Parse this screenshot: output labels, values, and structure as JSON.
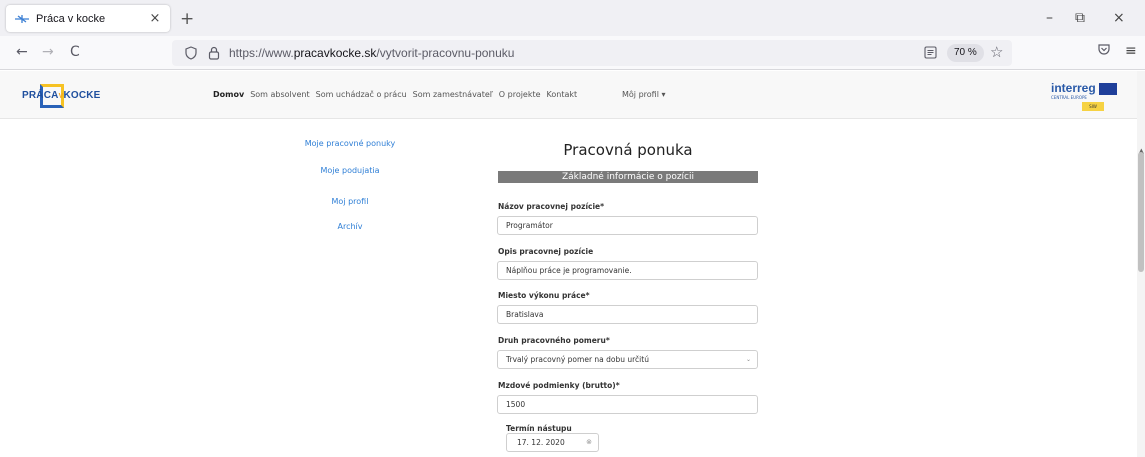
{
  "browser": {
    "tab_title": "Práca v kocke",
    "tab_close": "×",
    "new_tab": "+",
    "url_prefix": "https://www.",
    "url_domain": "pracavkocke.sk",
    "url_path": "/vytvorit-pracovnu-ponuku",
    "zoom": "70 %",
    "window_controls": {
      "minimize": "–",
      "restore": "⧉",
      "close": "×"
    },
    "nav": {
      "back": "←",
      "forward": "→",
      "reload": "C"
    },
    "star": "☆",
    "menu": "≡"
  },
  "site": {
    "logo_left": "PRÁCA",
    "logo_mid": "V",
    "logo_right": "KOCKE",
    "nav_items": [
      "Domov",
      "Som absolvent",
      "Som uchádzač o prácu",
      "Som zamestnávateľ",
      "O projekte",
      "Kontakt"
    ],
    "profile_menu": "Môj profil ▾",
    "interreg": "interreg",
    "interreg_sub": "CENTRAL EUROPE",
    "interreg_tag": "SIW"
  },
  "sidebar": {
    "items": [
      {
        "label": "Moje pracovné ponuky"
      },
      {
        "label": "Moje podujatia"
      },
      {
        "label": "Moj profil"
      },
      {
        "label": "Archív"
      }
    ]
  },
  "form": {
    "title": "Pracovná ponuka",
    "section": "Základné informácie o pozícii",
    "fields": [
      {
        "label": "Názov pracovnej pozície*",
        "value": "Programátor"
      },
      {
        "label": "Opis pracovnej pozície",
        "value": "Náplňou práce je programovanie."
      },
      {
        "label": "Miesto výkonu práce*",
        "value": "Bratislava"
      },
      {
        "label": "Druh pracovného pomeru*",
        "value": "Trvalý pracovný pomer na dobu určitú"
      },
      {
        "label": "Mzdové podmienky (brutto)*",
        "value": "1500"
      }
    ],
    "start_date_label": "Termín nástupu",
    "start_date_value": "17. 12. 2020",
    "date_clear": "⊗",
    "select_arrow": "⌄"
  },
  "colors": {
    "link": "#2f7fd6",
    "section_bar": "#7a7a7a",
    "brand_blue": "#1f4f9e",
    "brand_yellow": "#f6c223"
  }
}
